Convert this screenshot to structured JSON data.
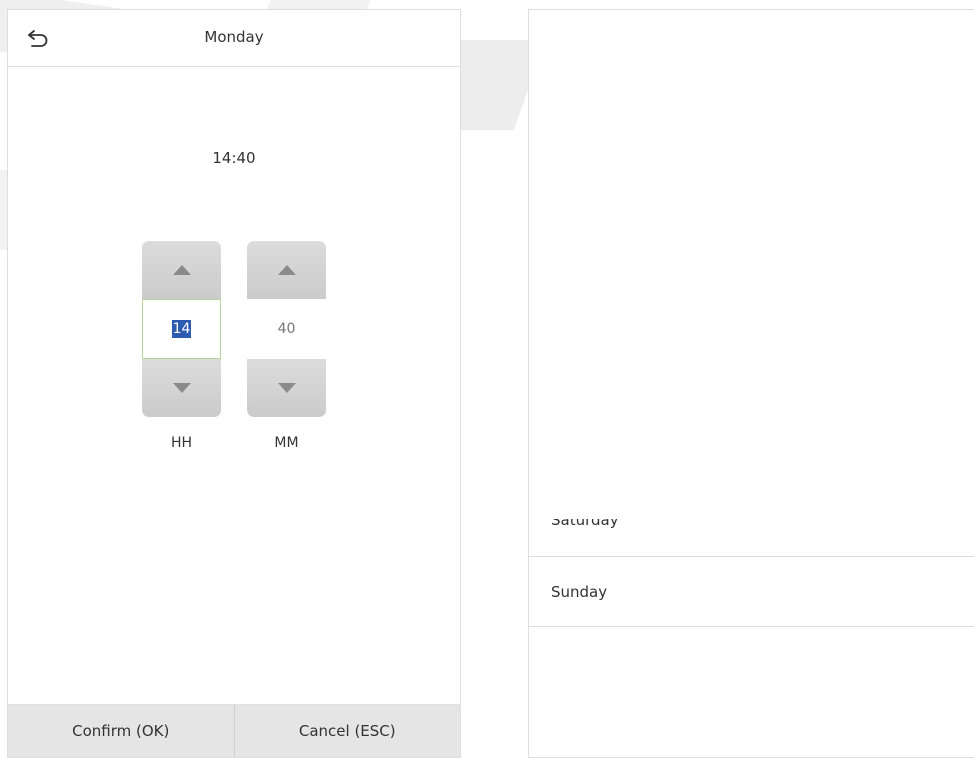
{
  "dialog": {
    "title": "Monday",
    "time_display": "14:40",
    "hour": {
      "value": "14",
      "label": "HH"
    },
    "minute": {
      "value": "40",
      "label": "MM"
    },
    "confirm_label": "Confirm (OK)",
    "cancel_label": "Cancel (ESC)"
  },
  "day_list": {
    "items": [
      "Saturday",
      "Sunday"
    ]
  },
  "icons": {
    "back": "back-arrow-icon",
    "increment": "triangle-up-icon",
    "decrement": "triangle-down-icon"
  }
}
